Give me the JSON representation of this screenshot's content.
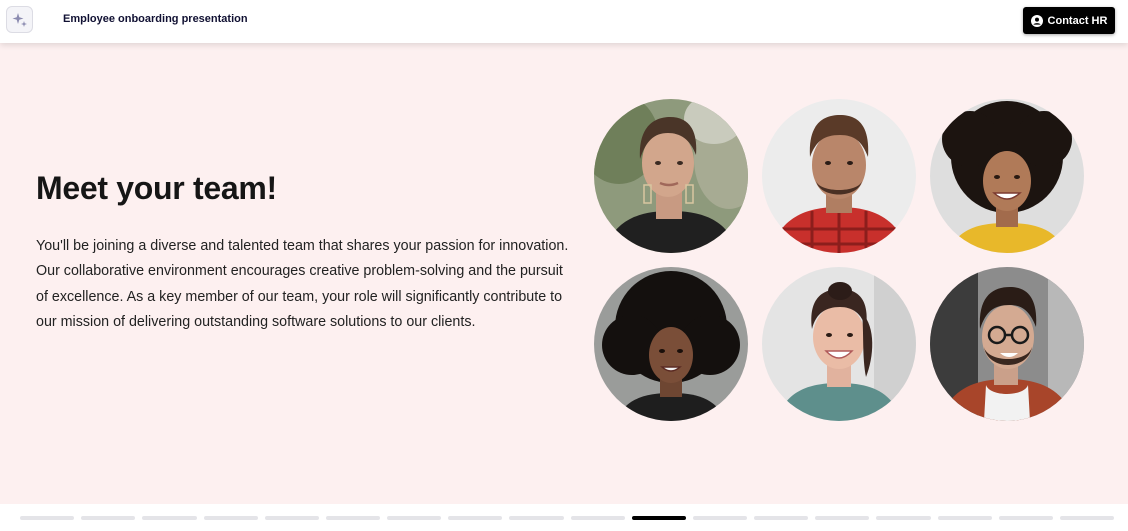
{
  "header": {
    "title": "Employee onboarding presentation",
    "logo_icon": "sparkle-icon",
    "contact_button": {
      "label": "Contact HR",
      "icon": "user-circle-icon"
    }
  },
  "slide": {
    "heading": "Meet your team!",
    "body": "You'll be joining a diverse and talented team that shares your passion for innovation. Our collaborative environment encourages creative problem-solving and the pursuit of excellence. As a key member of our team, your role will significantly contribute to our mission of delivering outstanding software solutions to our clients.",
    "background_color": "#fdf0f0",
    "team_photos": [
      "team-member-photo-1",
      "team-member-photo-2",
      "team-member-photo-3",
      "team-member-photo-4",
      "team-member-photo-5",
      "team-member-photo-6"
    ]
  },
  "progress": {
    "total_slides": 18,
    "current_slide": 11,
    "active_color": "#000000",
    "inactive_color": "#e4e4e8"
  }
}
